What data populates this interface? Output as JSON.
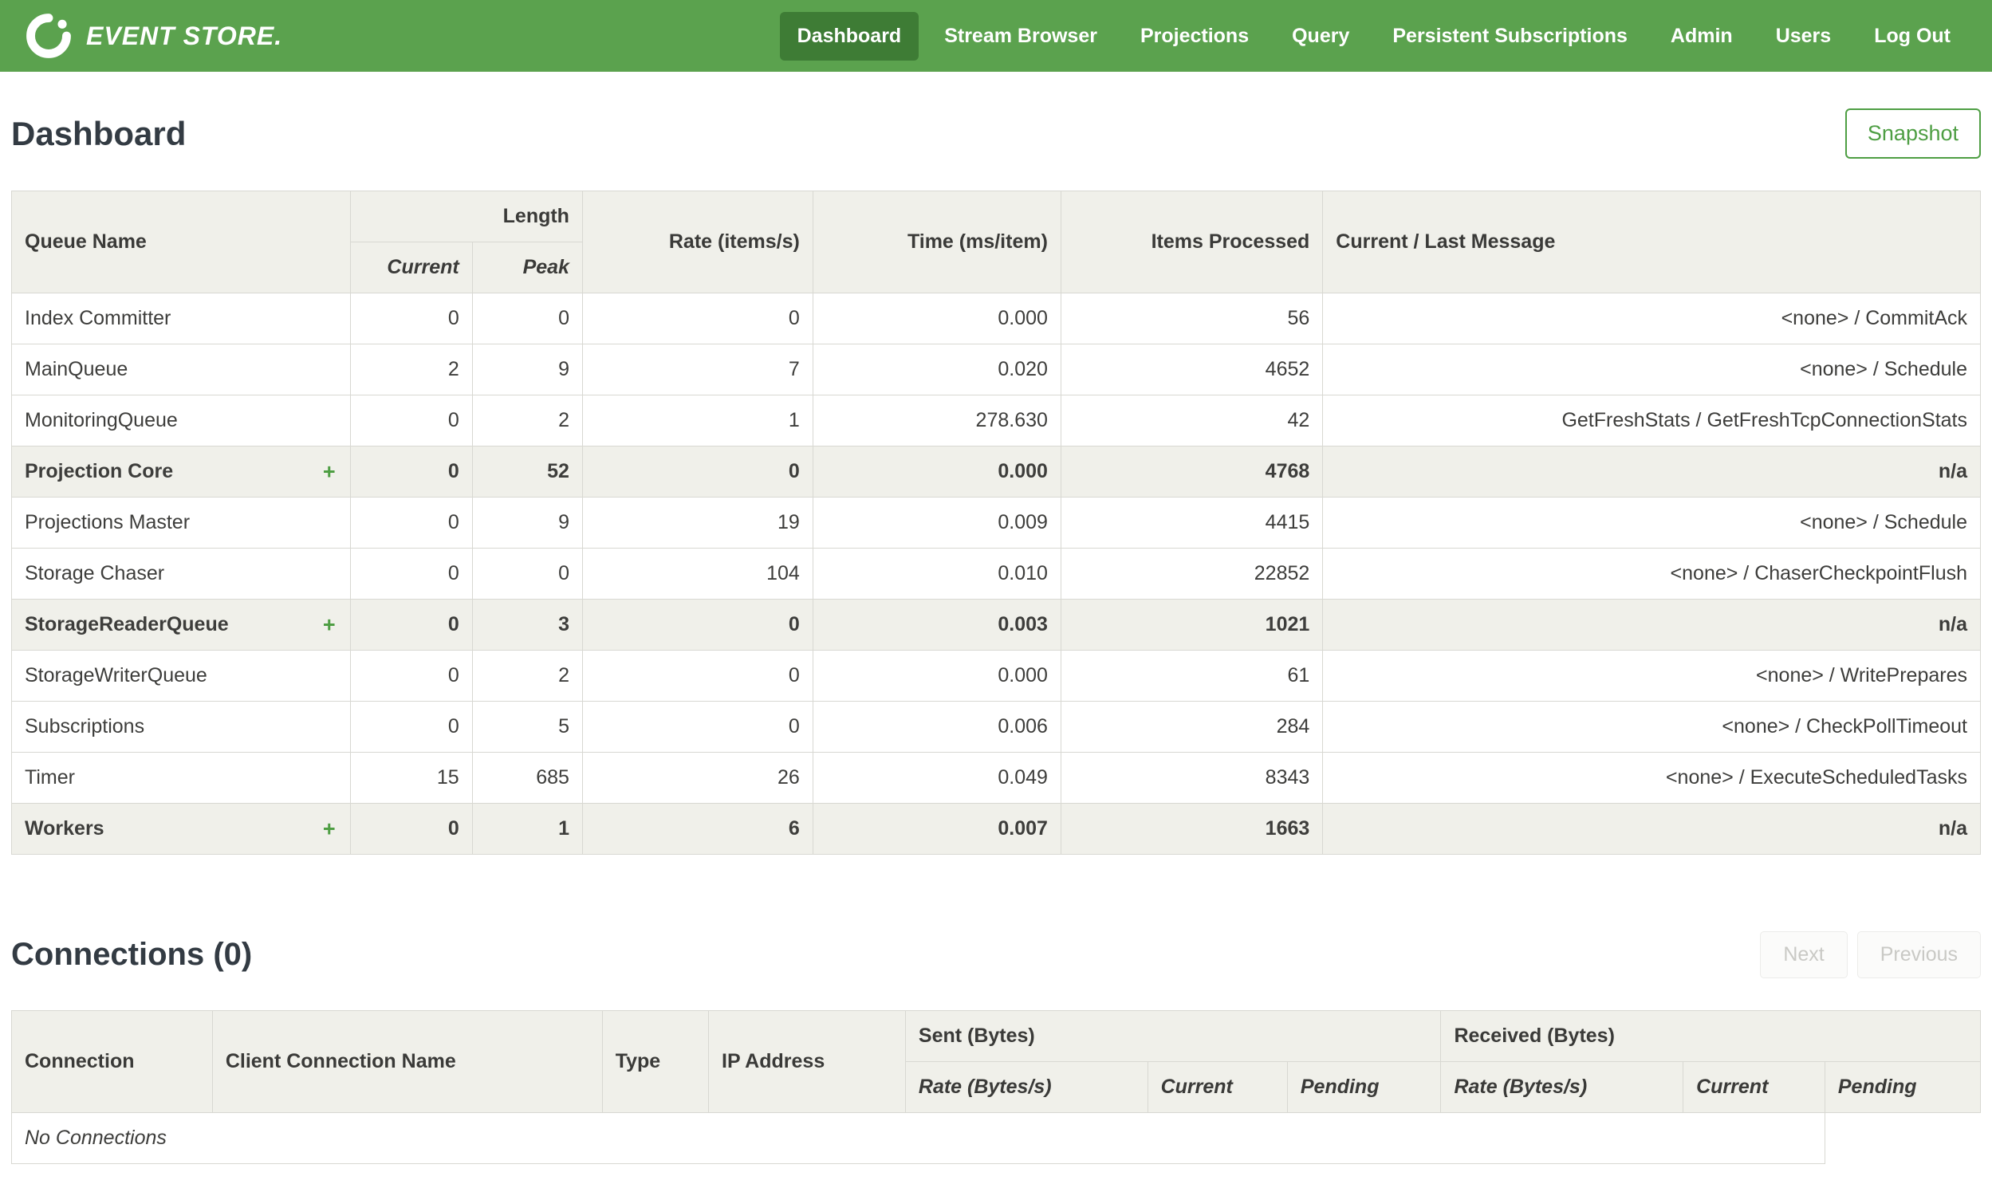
{
  "nav": {
    "brand": "EVENT STORE.",
    "items": [
      {
        "label": "Dashboard",
        "active": true
      },
      {
        "label": "Stream Browser",
        "active": false
      },
      {
        "label": "Projections",
        "active": false
      },
      {
        "label": "Query",
        "active": false
      },
      {
        "label": "Persistent Subscriptions",
        "active": false
      },
      {
        "label": "Admin",
        "active": false
      },
      {
        "label": "Users",
        "active": false
      },
      {
        "label": "Log Out",
        "active": false
      }
    ]
  },
  "page": {
    "title": "Dashboard",
    "snapshot_button": "Snapshot"
  },
  "colors": {
    "nav_green": "#5ba24e",
    "nav_active_green": "#3e7c35",
    "accent_green": "#4e9e43",
    "header_bg": "#f0f0ea",
    "border": "#d8d8d2"
  },
  "queues_table": {
    "headers": {
      "queue_name": "Queue Name",
      "length": "Length",
      "current": "Current",
      "peak": "Peak",
      "rate": "Rate (items/s)",
      "time": "Time (ms/item)",
      "items_processed": "Items Processed",
      "message": "Current / Last Message"
    },
    "rows": [
      {
        "name": "Index Committer",
        "group": false,
        "current": "0",
        "peak": "0",
        "rate": "0",
        "time": "0.000",
        "items": "56",
        "message": "<none> / CommitAck"
      },
      {
        "name": "MainQueue",
        "group": false,
        "current": "2",
        "peak": "9",
        "rate": "7",
        "time": "0.020",
        "items": "4652",
        "message": "<none> / Schedule"
      },
      {
        "name": "MonitoringQueue",
        "group": false,
        "current": "0",
        "peak": "2",
        "rate": "1",
        "time": "278.630",
        "items": "42",
        "message": "GetFreshStats / GetFreshTcpConnectionStats"
      },
      {
        "name": "Projection Core",
        "group": true,
        "current": "0",
        "peak": "52",
        "rate": "0",
        "time": "0.000",
        "items": "4768",
        "message": "n/a"
      },
      {
        "name": "Projections Master",
        "group": false,
        "current": "0",
        "peak": "9",
        "rate": "19",
        "time": "0.009",
        "items": "4415",
        "message": "<none> / Schedule"
      },
      {
        "name": "Storage Chaser",
        "group": false,
        "current": "0",
        "peak": "0",
        "rate": "104",
        "time": "0.010",
        "items": "22852",
        "message": "<none> / ChaserCheckpointFlush"
      },
      {
        "name": "StorageReaderQueue",
        "group": true,
        "current": "0",
        "peak": "3",
        "rate": "0",
        "time": "0.003",
        "items": "1021",
        "message": "n/a"
      },
      {
        "name": "StorageWriterQueue",
        "group": false,
        "current": "0",
        "peak": "2",
        "rate": "0",
        "time": "0.000",
        "items": "61",
        "message": "<none> / WritePrepares"
      },
      {
        "name": "Subscriptions",
        "group": false,
        "current": "0",
        "peak": "5",
        "rate": "0",
        "time": "0.006",
        "items": "284",
        "message": "<none> / CheckPollTimeout"
      },
      {
        "name": "Timer",
        "group": false,
        "current": "15",
        "peak": "685",
        "rate": "26",
        "time": "0.049",
        "items": "8343",
        "message": "<none> / ExecuteScheduledTasks"
      },
      {
        "name": "Workers",
        "group": true,
        "current": "0",
        "peak": "1",
        "rate": "6",
        "time": "0.007",
        "items": "1663",
        "message": "n/a"
      }
    ],
    "expand_symbol": "+"
  },
  "connections": {
    "title": "Connections (0)",
    "next_button": "Next",
    "previous_button": "Previous",
    "headers": {
      "connection": "Connection",
      "client_connection_name": "Client Connection Name",
      "type": "Type",
      "ip_address": "IP Address",
      "sent": "Sent (Bytes)",
      "received": "Received (Bytes)",
      "rate": "Rate (Bytes/s)",
      "current": "Current",
      "pending": "Pending"
    },
    "empty_message": "No Connections"
  }
}
